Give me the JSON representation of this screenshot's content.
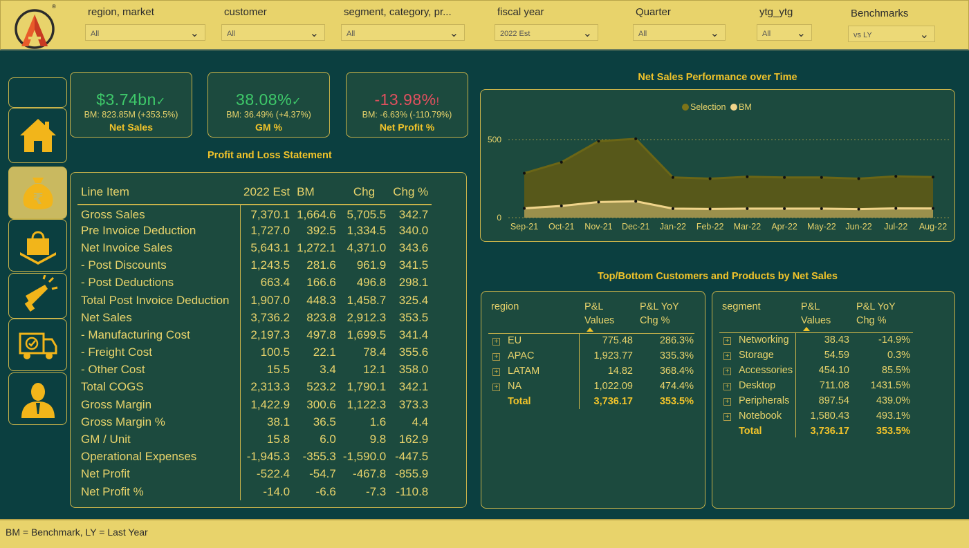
{
  "filters": [
    {
      "label": "region, market",
      "value": "All"
    },
    {
      "label": "customer",
      "value": "All"
    },
    {
      "label": "segment, category, pr...",
      "value": "All"
    },
    {
      "label": "fiscal year",
      "value": "2022 Est"
    },
    {
      "label": "Quarter",
      "value": "All"
    },
    {
      "label": "ytg_ytg",
      "value": "All"
    },
    {
      "label": "Benchmarks",
      "value": "vs LY"
    }
  ],
  "logo": {
    "mark": "®"
  },
  "nav": [
    {
      "icon": "home-icon"
    },
    {
      "icon": "money-bag-rupee-icon",
      "active": true
    },
    {
      "icon": "shopping-bag-icon"
    },
    {
      "icon": "megaphone-icon"
    },
    {
      "icon": "delivery-truck-icon"
    },
    {
      "icon": "person-icon"
    }
  ],
  "kpis": [
    {
      "value": "$3.74bn",
      "indicator": "✓",
      "bm": "BM: 823.85M (+353.5%)",
      "name": "Net Sales",
      "status_color": "#3ec96a"
    },
    {
      "value": "38.08%",
      "indicator": "✓",
      "bm": "BM: 36.49% (+4.37%)",
      "name": "GM %",
      "status_color": "#3ec96a"
    },
    {
      "value": "-13.98%",
      "indicator": "!",
      "bm": "BM: -6.63% (-110.79%)",
      "name": "Net Profit %",
      "status_color": "#e0505e"
    }
  ],
  "pl": {
    "title": "Profit and Loss Statement",
    "columns": [
      "Line Item",
      "2022 Est",
      "BM",
      "Chg",
      "Chg %"
    ],
    "rows": [
      [
        "Gross Sales",
        "7,370.1",
        "1,664.6",
        "5,705.5",
        "342.7"
      ],
      [
        "Pre Invoice Deduction",
        "1,727.0",
        "392.5",
        "1,334.5",
        "340.0"
      ],
      [
        "Net Invoice Sales",
        "5,643.1",
        "1,272.1",
        "4,371.0",
        "343.6"
      ],
      [
        "- Post Discounts",
        "1,243.5",
        "281.6",
        "961.9",
        "341.5"
      ],
      [
        "- Post Deductions",
        "663.4",
        "166.6",
        "496.8",
        "298.1"
      ],
      [
        "Total Post Invoice Deduction",
        "1,907.0",
        "448.3",
        "1,458.7",
        "325.4"
      ],
      [
        "Net Sales",
        "3,736.2",
        "823.8",
        "2,912.3",
        "353.5"
      ],
      [
        "- Manufacturing Cost",
        "2,197.3",
        "497.8",
        "1,699.5",
        "341.4"
      ],
      [
        "- Freight Cost",
        "100.5",
        "22.1",
        "78.4",
        "355.6"
      ],
      [
        "- Other Cost",
        "15.5",
        "3.4",
        "12.1",
        "358.0"
      ],
      [
        "Total COGS",
        "2,313.3",
        "523.2",
        "1,790.1",
        "342.1"
      ],
      [
        "Gross Margin",
        "1,422.9",
        "300.6",
        "1,122.3",
        "373.3"
      ],
      [
        "Gross Margin %",
        "38.1",
        "36.5",
        "1.6",
        "4.4"
      ],
      [
        "GM / Unit",
        "15.8",
        "6.0",
        "9.8",
        "162.9"
      ],
      [
        "Operational Expenses",
        "-1,945.3",
        "-355.3",
        "-1,590.0",
        "-447.5"
      ],
      [
        "Net Profit",
        "-522.4",
        "-54.7",
        "-467.8",
        "-855.9"
      ],
      [
        "Net Profit %",
        "-14.0",
        "-6.6",
        "-7.3",
        "-110.8"
      ]
    ]
  },
  "chart_data": {
    "type": "area",
    "title": "Net Sales Performance over Time",
    "categories": [
      "Sep-21",
      "Oct-21",
      "Nov-21",
      "Dec-21",
      "Jan-22",
      "Feb-22",
      "Mar-22",
      "Apr-22",
      "May-22",
      "Jun-22",
      "Jul-22",
      "Aug-22"
    ],
    "series": [
      {
        "name": "Selection",
        "color": "#5e5a16",
        "values": [
          285,
          355,
          490,
          505,
          258,
          250,
          262,
          258,
          258,
          250,
          265,
          260
        ]
      },
      {
        "name": "BM",
        "color": "#f0d48a",
        "values": [
          60,
          75,
          100,
          105,
          58,
          56,
          58,
          58,
          58,
          55,
          60,
          59
        ]
      }
    ],
    "yticks": [
      0,
      500
    ],
    "ylim": [
      0,
      560
    ],
    "legend_position": "top-center",
    "grid": true
  },
  "topbottom": {
    "title": "Top/Bottom Customers and Products by Net Sales",
    "region_table": {
      "headers": [
        "region",
        "P&L\nValues",
        "P&L YoY\nChg %"
      ],
      "rows": [
        [
          "EU",
          "775.48",
          "286.3%"
        ],
        [
          "APAC",
          "1,923.77",
          "335.3%"
        ],
        [
          "LATAM",
          "14.82",
          "368.4%"
        ],
        [
          "NA",
          "1,022.09",
          "474.4%"
        ]
      ],
      "total": [
        "Total",
        "3,736.17",
        "353.5%"
      ]
    },
    "segment_table": {
      "headers": [
        "segment",
        "P&L\nValues",
        "P&L YoY\nChg %"
      ],
      "rows": [
        [
          "Networking",
          "38.43",
          "-14.9%"
        ],
        [
          "Storage",
          "54.59",
          "0.3%"
        ],
        [
          "Accessories",
          "454.10",
          "85.5%"
        ],
        [
          "Desktop",
          "711.08",
          "1431.5%"
        ],
        [
          "Peripherals",
          "897.54",
          "439.0%"
        ],
        [
          "Notebook",
          "1,580.43",
          "493.1%"
        ]
      ],
      "total": [
        "Total",
        "3,736.17",
        "353.5%"
      ]
    }
  },
  "footer": {
    "text": "BM = Benchmark, LY = Last Year"
  }
}
